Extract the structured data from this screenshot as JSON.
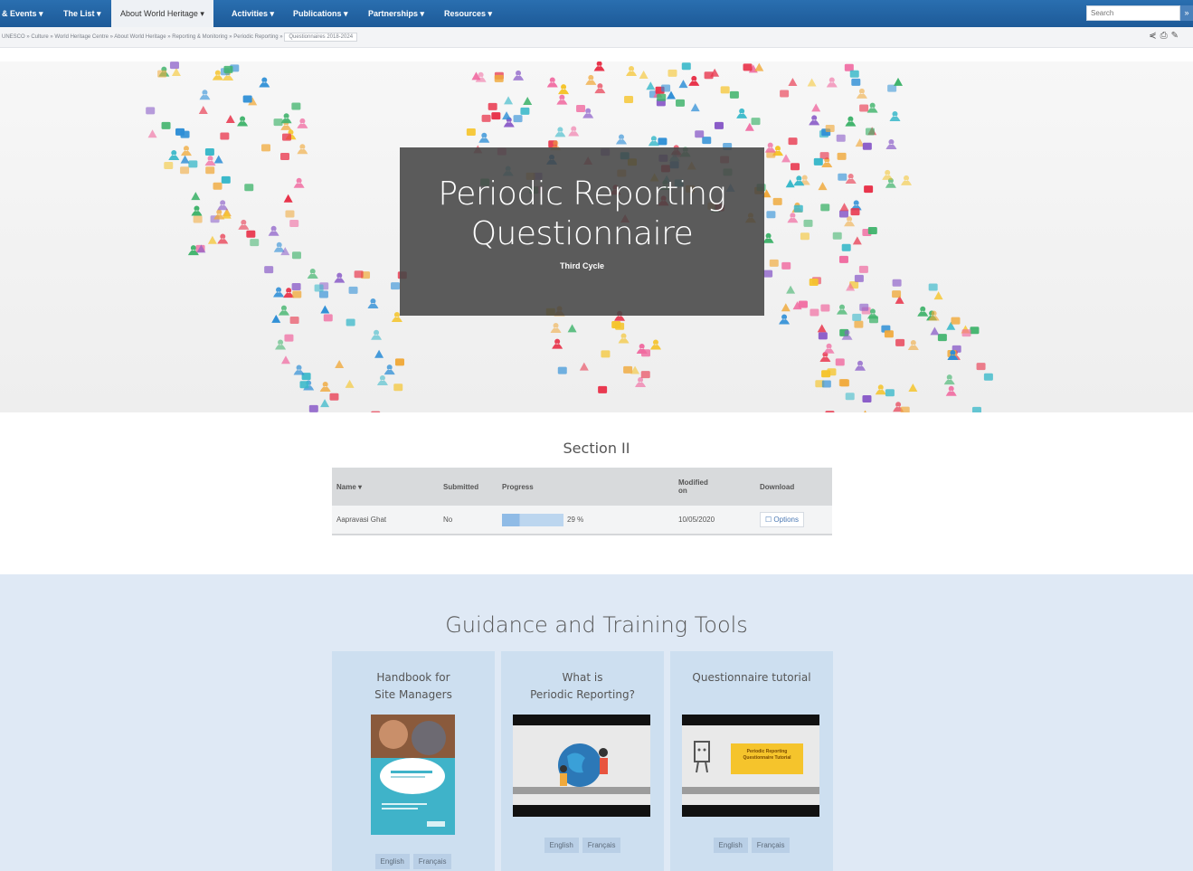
{
  "nav": {
    "items": [
      "& Events",
      "The List",
      "About World Heritage",
      "Activities",
      "Publications",
      "Partnerships",
      "Resources"
    ],
    "active_index": 2,
    "search_placeholder": "Search",
    "search_button": "»"
  },
  "breadcrumb": {
    "items": [
      "UNESCO",
      "Culture",
      "World Heritage Centre",
      "About World Heritage",
      "Reporting & Monitoring",
      "Periodic Reporting"
    ],
    "current": "Questionnaires 2018-2024",
    "tools": [
      "share-icon",
      "print-icon",
      "edit-icon"
    ]
  },
  "hero": {
    "title_line1": "Periodic Reporting",
    "title_line2": "Questionnaire",
    "subtitle": "Third Cycle"
  },
  "section": {
    "title": "Section II",
    "headers": {
      "name": "Name",
      "submitted": "Submitted",
      "progress": "Progress",
      "modified_line1": "Modified",
      "modified_line2": "on",
      "download": "Download"
    },
    "rows": [
      {
        "name": "Aapravasi Ghat",
        "submitted": "No",
        "progress_label": "29 %",
        "progress": 0.29,
        "modified": "10/05/2020",
        "download": "Options"
      }
    ]
  },
  "guidance": {
    "title": "Guidance and Training Tools",
    "cards": [
      {
        "title_line1": "Handbook for",
        "title_line2": "Site Managers",
        "buttons": [
          "English",
          "Français"
        ]
      },
      {
        "title_line1": "What is",
        "title_line2": "Periodic Reporting?",
        "buttons": [
          "English",
          "Français"
        ]
      },
      {
        "title_line1": "Questionnaire tutorial",
        "title_line2": "",
        "buttons": [
          "English",
          "Français"
        ],
        "video_caption": "Periodic Reporting Questionnaire Tutorial"
      }
    ]
  }
}
